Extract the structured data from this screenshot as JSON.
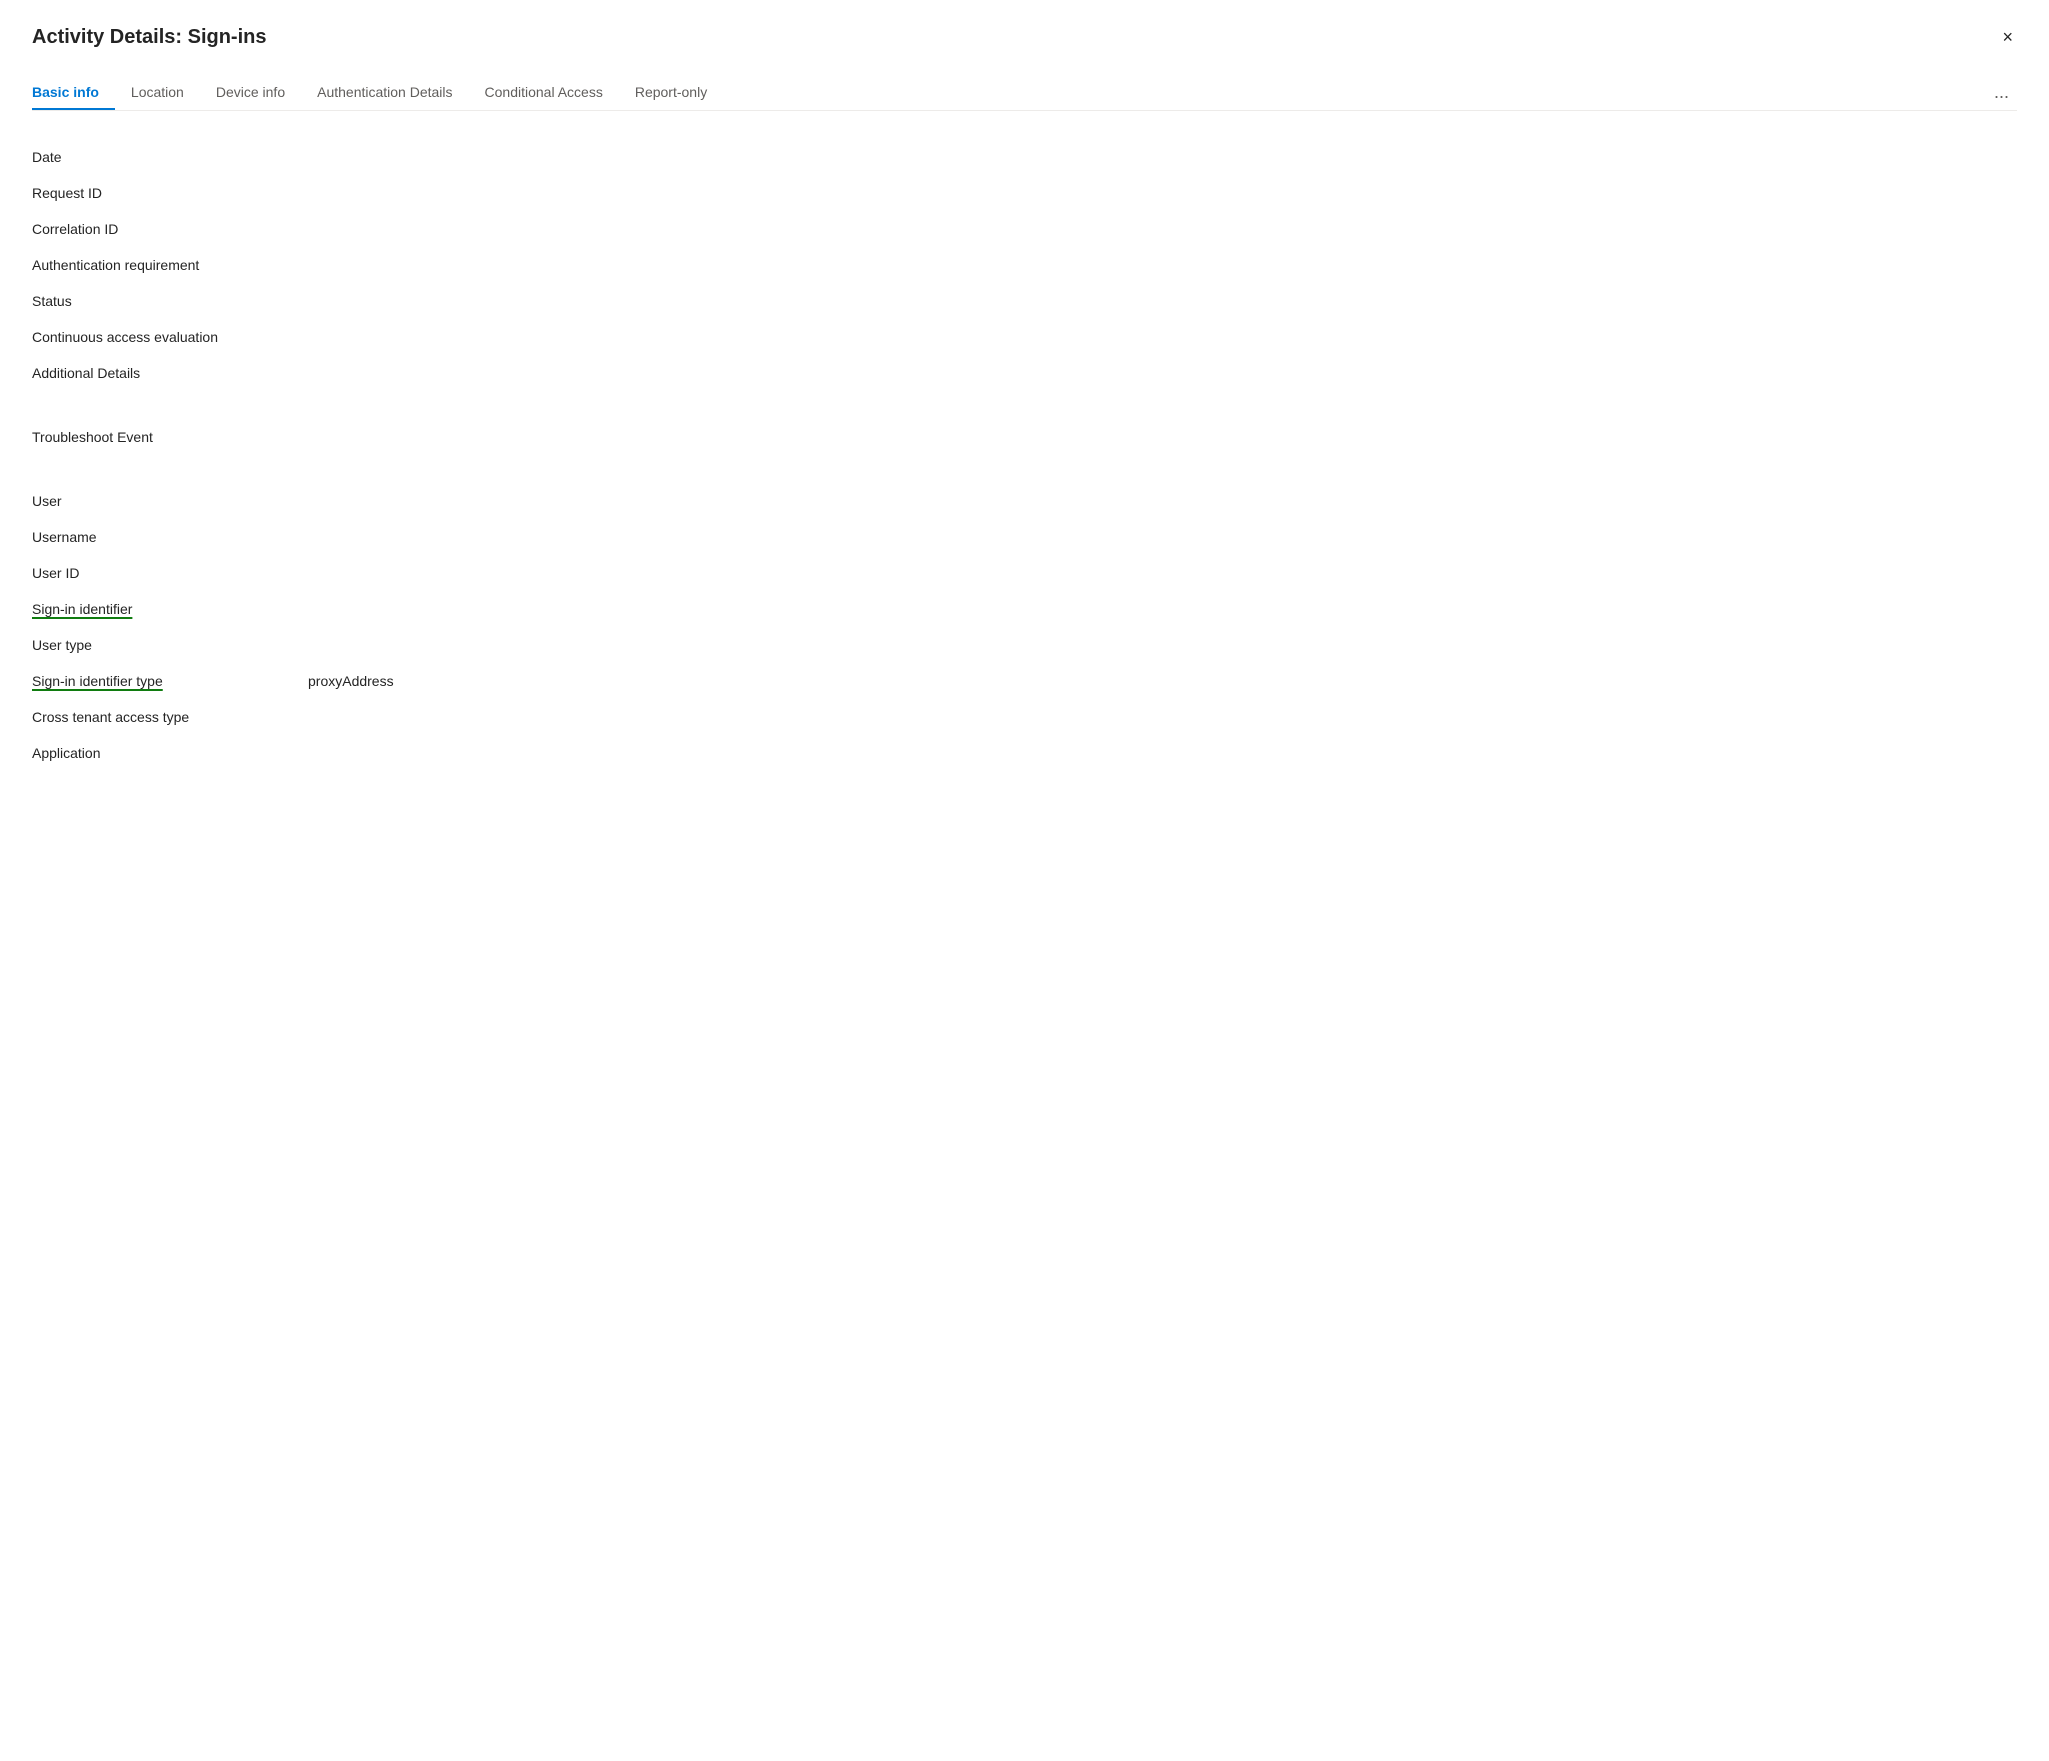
{
  "dialog": {
    "title": "Activity Details: Sign-ins",
    "close_label": "×"
  },
  "tabs": [
    {
      "id": "basic-info",
      "label": "Basic info",
      "active": true
    },
    {
      "id": "location",
      "label": "Location",
      "active": false
    },
    {
      "id": "device-info",
      "label": "Device info",
      "active": false
    },
    {
      "id": "authentication-details",
      "label": "Authentication Details",
      "active": false
    },
    {
      "id": "conditional-access",
      "label": "Conditional Access",
      "active": false
    },
    {
      "id": "report-only",
      "label": "Report-only",
      "active": false
    }
  ],
  "tab_more": "...",
  "fields_section1": [
    {
      "id": "date",
      "label": "Date",
      "value": "",
      "underlined": false
    },
    {
      "id": "request-id",
      "label": "Request ID",
      "value": "",
      "underlined": false
    },
    {
      "id": "correlation-id",
      "label": "Correlation ID",
      "value": "",
      "underlined": false
    },
    {
      "id": "auth-requirement",
      "label": "Authentication requirement",
      "value": "",
      "underlined": false
    },
    {
      "id": "status",
      "label": "Status",
      "value": "",
      "underlined": false
    },
    {
      "id": "continuous-access",
      "label": "Continuous access evaluation",
      "value": "",
      "underlined": false
    },
    {
      "id": "additional-details",
      "label": "Additional Details",
      "value": "",
      "underlined": false
    }
  ],
  "fields_section2": [
    {
      "id": "troubleshoot-event",
      "label": "Troubleshoot Event",
      "value": "",
      "underlined": false
    }
  ],
  "fields_section3": [
    {
      "id": "user",
      "label": "User",
      "value": "",
      "underlined": false
    },
    {
      "id": "username",
      "label": "Username",
      "value": "",
      "underlined": false
    },
    {
      "id": "user-id",
      "label": "User ID",
      "value": "",
      "underlined": false
    },
    {
      "id": "sign-in-identifier",
      "label": "Sign-in identifier",
      "value": "",
      "underlined": true
    },
    {
      "id": "user-type",
      "label": "User type",
      "value": "",
      "underlined": false
    },
    {
      "id": "sign-in-identifier-type",
      "label": "Sign-in identifier type",
      "value": "proxyAddress",
      "underlined": true
    },
    {
      "id": "cross-tenant-access-type",
      "label": "Cross tenant access type",
      "value": "",
      "underlined": false
    },
    {
      "id": "application",
      "label": "Application",
      "value": "",
      "underlined": false
    }
  ]
}
